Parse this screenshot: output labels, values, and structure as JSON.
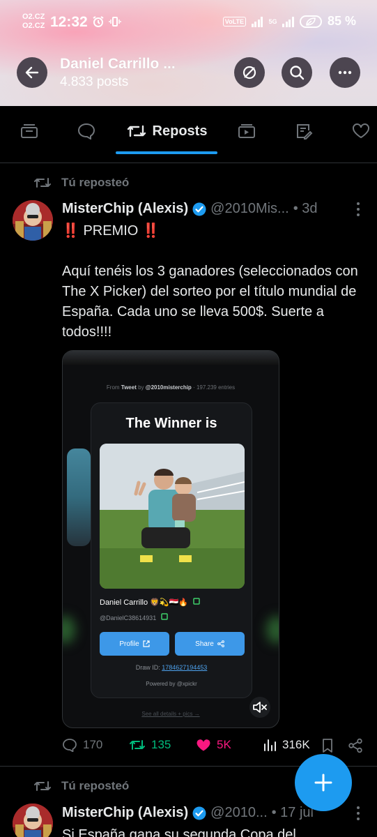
{
  "status_bar": {
    "carrier_top": "O2.CZ",
    "carrier_bottom": "O2.CZ",
    "time": "12:32",
    "volte": "VoLTE",
    "network": "5G",
    "battery": "85 %"
  },
  "header": {
    "name": "Daniel Carrillo ...",
    "posts": "4.833 posts"
  },
  "tabs": [
    {
      "icon": "posts-icon"
    },
    {
      "icon": "replies-icon"
    },
    {
      "label": "Reposts",
      "active": true
    },
    {
      "icon": "media-icon"
    },
    {
      "icon": "articles-icon"
    },
    {
      "icon": "likes-icon"
    }
  ],
  "posts": [
    {
      "repost_label": "Tú reposteó",
      "author_name": "MisterChip (Alexis)",
      "author_handle": "@2010Mis...",
      "age": "• 3d",
      "text_line1": "PREMIO",
      "text_bang": "‼️",
      "text_body": "Aquí tenéis los 3 ganadores (seleccionados con The X Picker) del sorteo por el título mundial de España. Cada uno se lleva 500$. Suerte a todos!!!!",
      "media": {
        "from_prefix": "From ",
        "from_tweet": "Tweet",
        "from_by": " by ",
        "from_account": "@2010misterchip",
        "from_entries": " · 197.239 entries",
        "title": "The Winner is",
        "winner_name": "Daniel Carrillo 🦁💫🇪🇬🔥",
        "winner_handle": "@DanielC38614931",
        "profile_btn": "Profile",
        "share_btn": "Share",
        "draw_id_label": "Draw ID: ",
        "draw_id": "1784627194453",
        "powered": "Powered by @xpickr",
        "see_all": "See all details + pics →"
      },
      "stats": {
        "replies": "170",
        "reposts": "135",
        "likes": "5K",
        "views": "316K"
      }
    },
    {
      "repost_label": "Tú reposteó",
      "author_name": "MisterChip (Alexis)",
      "author_handle": "@2010...",
      "age": "• 17 jul",
      "text_body": "Si España gana su segunda Copa del"
    }
  ],
  "colors": {
    "accent": "#1d9bf0",
    "muted": "#71767b",
    "repost_green": "#00ba7c",
    "like_pink": "#f91880"
  }
}
